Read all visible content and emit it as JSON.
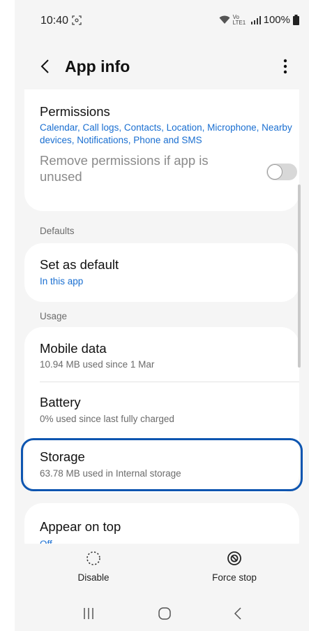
{
  "status_bar": {
    "time": "10:40",
    "network": "Vo LTE1",
    "battery": "100%"
  },
  "header": {
    "title": "App info",
    "back_icon": "chevron-left-icon",
    "more_icon": "more-vertical-icon"
  },
  "permissions": {
    "title": "Permissions",
    "list": "Calendar, Call logs, Contacts, Location, Microphone, Nearby devices, Notifications, Phone and SMS",
    "remove_label": "Remove permissions if app is unused",
    "remove_enabled": false
  },
  "defaults": {
    "section_label": "Defaults",
    "set_as_default_title": "Set as default",
    "set_as_default_sub": "In this app"
  },
  "usage": {
    "section_label": "Usage",
    "items": [
      {
        "title": "Mobile data",
        "sub": "10.94 MB used since 1 Mar"
      },
      {
        "title": "Battery",
        "sub": "0% used since last fully charged"
      },
      {
        "title": "Storage",
        "sub": "63.78 MB used in Internal storage"
      }
    ]
  },
  "appear_on_top": {
    "title": "Appear on top",
    "sub": "Off"
  },
  "actions": {
    "disable": "Disable",
    "force_stop": "Force stop"
  },
  "colors": {
    "accent": "#1a6fd1",
    "highlight": "#0d55b0",
    "background": "#f5f5f5"
  }
}
